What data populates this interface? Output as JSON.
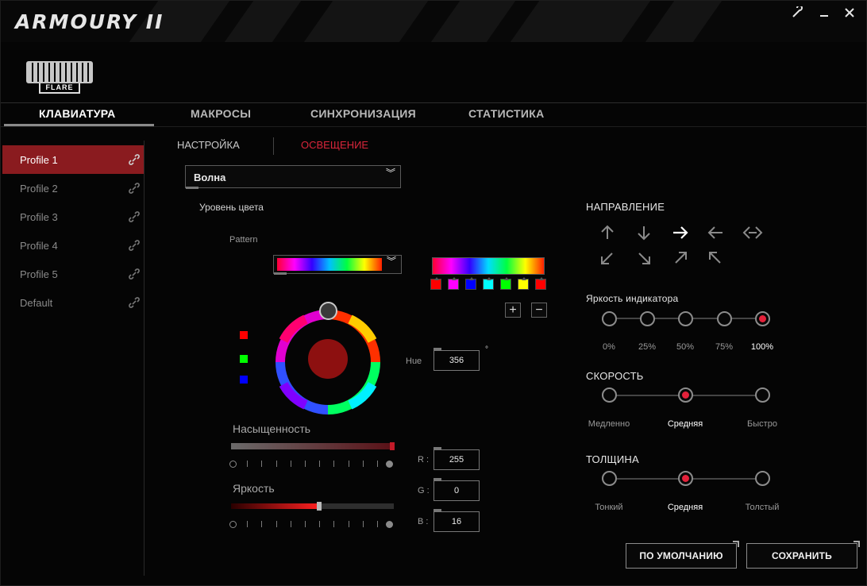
{
  "app": {
    "title": "ARMOURY II",
    "device_name": "FLARE"
  },
  "window_controls": {
    "settings_icon": "wrench-icon",
    "minimize_icon": "minimize-icon",
    "close_icon": "close-icon"
  },
  "main_tabs": [
    {
      "label": "КЛАВИАТУРА",
      "active": true
    },
    {
      "label": "МАКРОСЫ",
      "active": false
    },
    {
      "label": "СИНХРОНИЗАЦИЯ",
      "active": false
    },
    {
      "label": "СТАТИСТИКА",
      "active": false
    }
  ],
  "profiles": [
    {
      "label": "Profile 1",
      "active": true,
      "icon": "link-icon"
    },
    {
      "label": "Profile 2",
      "active": false,
      "icon": "link-icon"
    },
    {
      "label": "Profile 3",
      "active": false,
      "icon": "link-icon"
    },
    {
      "label": "Profile 4",
      "active": false,
      "icon": "link-icon"
    },
    {
      "label": "Profile 5",
      "active": false,
      "icon": "link-icon"
    },
    {
      "label": "Default",
      "active": false,
      "icon": "link-icon"
    }
  ],
  "sub_tabs": [
    {
      "label": "НАСТРОЙКА",
      "active": false,
      "color": "#c9c9c9"
    },
    {
      "label": "ОСВЕЩЕНИЕ",
      "active": true,
      "color": "#d9253a"
    }
  ],
  "lighting": {
    "effect": "Волна",
    "color_level_label": "Уровень цвета",
    "pattern_label": "Pattern",
    "gradient_stops": [
      "#ff0000",
      "#ff00ff",
      "#0000ff",
      "#00ffff",
      "#00ff00",
      "#ffff00",
      "#ff0000"
    ],
    "add_label": "+",
    "remove_label": "−",
    "channel_colors": [
      "#ff0000",
      "#00ff00",
      "#0000ff"
    ],
    "current_color": "#8d1010",
    "hue_label": "Hue",
    "hue_value": "356",
    "degree_symbol": "°",
    "saturation_label": "Насыщенность",
    "saturation_level": 1.0,
    "brightness_label": "Яркость",
    "brightness_level": 0.54,
    "r_label": "R :",
    "r_value": "255",
    "g_label": "G :",
    "g_value": "0",
    "b_label": "B :",
    "b_value": "16"
  },
  "direction": {
    "title": "НАПРАВЛЕНИЕ",
    "icons": [
      "arrow-up-icon",
      "arrow-down-icon",
      "arrow-right-icon",
      "arrow-left-icon",
      "arrow-left-right-icon",
      "arrow-down-left-icon",
      "arrow-down-right-icon",
      "arrow-up-right-icon",
      "arrow-up-left-icon"
    ],
    "selected": "arrow-right-icon"
  },
  "indicator_brightness": {
    "title": "Яркость индикатора",
    "options": [
      "0%",
      "25%",
      "50%",
      "75%",
      "100%"
    ],
    "selected_index": 4
  },
  "speed": {
    "title": "СКОРОСТЬ",
    "options": [
      "Медленно",
      "Средняя",
      "Быстро"
    ],
    "selected_index": 1
  },
  "thickness": {
    "title": "ТОЛЩИНА",
    "options": [
      "Тонкий",
      "Средняя",
      "Толстый"
    ],
    "selected_index": 1
  },
  "buttons": {
    "default_label": "ПО УМОЛЧАНИЮ",
    "save_label": "СОХРАНИТЬ"
  },
  "colors": {
    "accent_red": "#8a1b1f",
    "active_subtab": "#d9253a"
  }
}
